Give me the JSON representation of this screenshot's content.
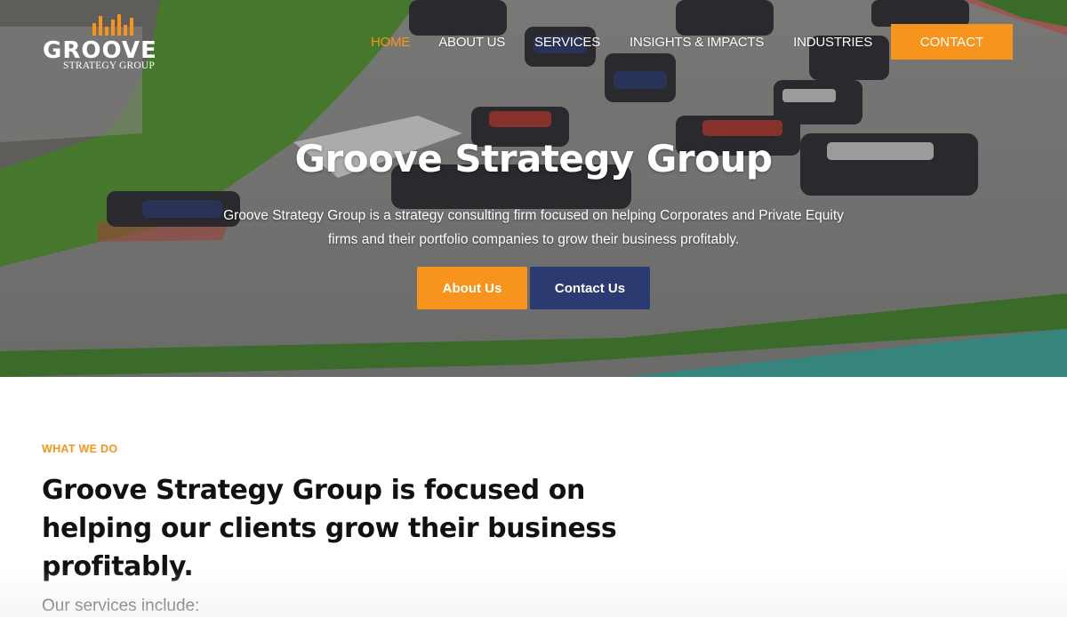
{
  "brand": {
    "logo_word": "GROOVE",
    "logo_sub": "STRATEGY GROUP",
    "accent_color": "#f7941d",
    "navy_color": "#2b3a70"
  },
  "nav": {
    "items": [
      {
        "label": "HOME",
        "active": true
      },
      {
        "label": "ABOUT US",
        "active": false
      },
      {
        "label": "SERVICES",
        "active": false
      },
      {
        "label": "INSIGHTS & IMPACTS",
        "active": false
      },
      {
        "label": "INDUSTRIES",
        "active": false
      }
    ],
    "contact_label": "CONTACT"
  },
  "hero": {
    "title": "Groove Strategy Group",
    "description": "Groove Strategy Group is a strategy consulting firm focused on helping Corporates and Private Equity firms and their portfolio companies to grow their business profitably.",
    "about_button": "About Us",
    "contact_button": "Contact Us",
    "background_image": "formula-one-race-cars-on-track"
  },
  "what_we_do": {
    "eyebrow": "WHAT WE DO",
    "title": "Groove Strategy Group is focused on helping our clients grow their business profitably.",
    "services_lead": "Our services include:"
  }
}
